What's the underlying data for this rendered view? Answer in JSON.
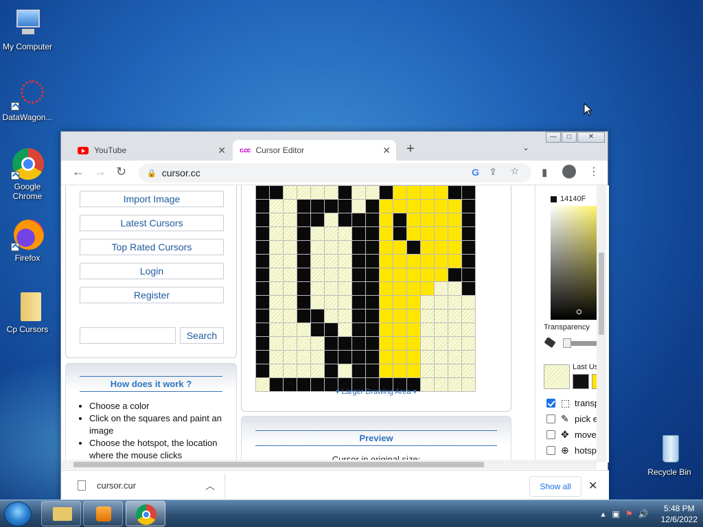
{
  "desktop": {
    "icons": [
      {
        "label": "My Computer"
      },
      {
        "label": "DataWagon..."
      },
      {
        "label": "Google Chrome"
      },
      {
        "label": "Firefox"
      },
      {
        "label": "Cp Cursors"
      },
      {
        "label": "Recycle Bin"
      }
    ]
  },
  "browser": {
    "tabs": [
      {
        "title": "YouTube"
      },
      {
        "title": "Cursor Editor",
        "favicon": "c.cc"
      }
    ],
    "address": "cursor.cc"
  },
  "page": {
    "nav": [
      "Import Image",
      "Latest Cursors",
      "Top Rated Cursors",
      "Login",
      "Register"
    ],
    "search_placeholder": "",
    "search_label": "Search",
    "how": {
      "title": "How does it work ?",
      "steps": [
        "Choose a color",
        "Click on the squares and paint an image",
        "Choose the hotspot, the location where the mouse clicks"
      ]
    },
    "larger_label": "Larger Drawing Area",
    "preview": {
      "title": "Preview",
      "subtitle": "Cursor in original size:"
    },
    "color": {
      "hex": "14140F",
      "transparency_label": "Transparency",
      "last_used_label": "Last Us"
    },
    "options": [
      {
        "label": "transp",
        "checked": true
      },
      {
        "label": "pick e",
        "checked": false
      },
      {
        "label": "move",
        "checked": false
      },
      {
        "label": "hotsp",
        "checked": false
      }
    ],
    "grid_rows": [
      "kkttttkttkyyyykk",
      "kttkkkktkyyyyyyk",
      "kttkktkkkykyyyyk",
      "kttktttkkykyyyyk",
      "kttktttkkyykyyyk",
      "kttktttkkyyyyyyk",
      "kttktttkkyyyyykk",
      "kttktttkkyyyyttk",
      "kttktttkkyyytttt",
      "kttkkttkkyyyttt",
      "ktttkktkkyyyttt",
      "kttttkkkkyyytttt",
      "kttttkkkkyyytttt",
      "kttttktkkyyytttt",
      "tkkkkkkkkkkktttt"
    ]
  },
  "downloads": {
    "file": "cursor.cur",
    "show_all": "Show all"
  },
  "taskbar": {
    "time": "5:48 PM",
    "date": "12/6/2022"
  }
}
